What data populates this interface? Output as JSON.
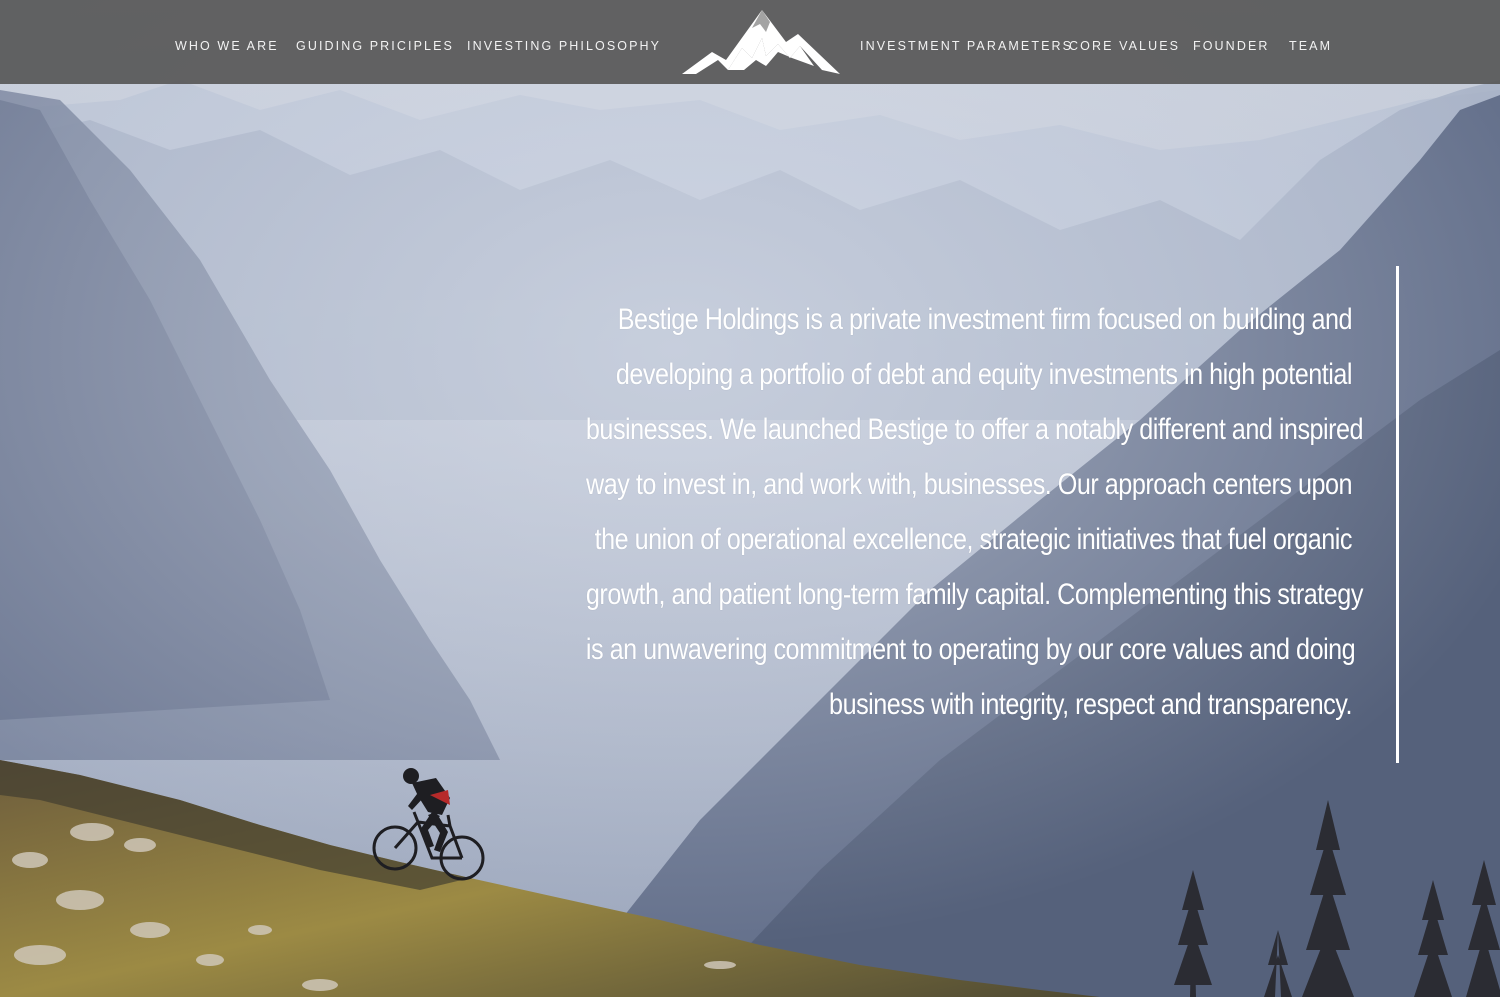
{
  "nav": {
    "left": [
      {
        "label": "WHO WE ARE"
      },
      {
        "label": "GUIDING PRICIPLES"
      },
      {
        "label": "INVESTING PHILOSOPHY"
      }
    ],
    "right": [
      {
        "label": "INVESTMENT PARAMETERS"
      },
      {
        "label": "CORE VALUES"
      },
      {
        "label": "FOUNDER"
      },
      {
        "label": "TEAM"
      }
    ],
    "logo_icon": "mountain-peaks-icon"
  },
  "hero": {
    "statement_lines": [
      "Bestige Holdings is a private investment firm focused on building and",
      "developing a portfolio of debt and equity investments in high potential",
      "businesses.  We launched Bestige to offer a notably different and inspired",
      "way to invest in, and work with, businesses.  Our approach centers upon",
      "the union of operational excellence, strategic initiatives that fuel organic",
      "growth, and patient long-term family capital.  Complementing this strategy",
      "is an unwavering commitment to operating by our core values and doing",
      "business with integrity, respect and transparency."
    ],
    "background_icon": "mountain-biker-landscape-photo"
  },
  "colors": {
    "nav_bg": "#585858",
    "nav_text": "#f2f2f2",
    "statement_text": "#ffffff",
    "accent_bar": "#ffffff"
  }
}
